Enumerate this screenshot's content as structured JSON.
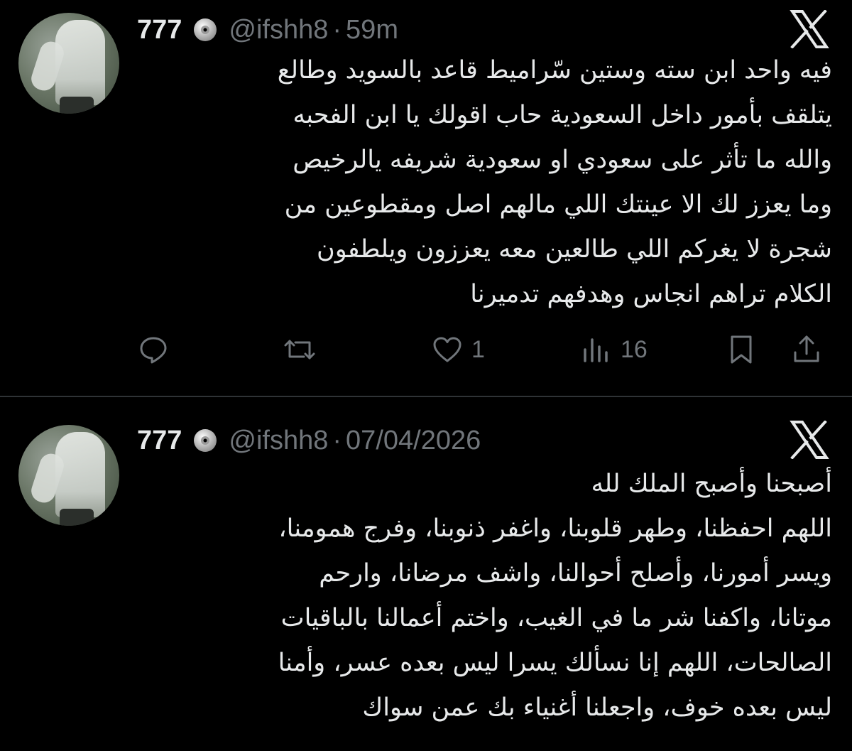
{
  "tweets": [
    {
      "author": {
        "name": "777",
        "handle": "@ifshh8",
        "badge_icon": "cd-disc-icon"
      },
      "separator": "·",
      "time": "59m",
      "platform_icon": "x-logo-icon",
      "text_lines": [
        "فيه واحد ابن سته وستين سّراميط قاعد بالسويد وطالع",
        "يتلقف بأمور داخل السعودية حاب اقولك يا ابن الفحبه",
        "والله ما تأثر على سعودي او سعودية شريفه يالرخيص",
        "وما يعزز لك الا عينتك اللي مالهم اصل ومقطوعين من",
        "شجرة لا يغركم اللي طالعين معه يعززون ويلطفون",
        "الكلام تراهم انجاس وهدفهم تدميرنا"
      ],
      "actions": {
        "reply": {
          "icon": "reply-icon",
          "count": ""
        },
        "retweet": {
          "icon": "retweet-icon",
          "count": ""
        },
        "like": {
          "icon": "heart-icon",
          "count": "1"
        },
        "views": {
          "icon": "views-icon",
          "count": "16"
        },
        "bookmark": {
          "icon": "bookmark-icon",
          "count": ""
        },
        "share": {
          "icon": "share-icon",
          "count": ""
        }
      }
    },
    {
      "author": {
        "name": "777",
        "handle": "@ifshh8",
        "badge_icon": "cd-disc-icon"
      },
      "separator": "·",
      "time": "07/04/2026",
      "platform_icon": "x-logo-icon",
      "text_lines": [
        "أصبحنا وأصبح الملك لله",
        "اللهم احفظنا، وطهر قلوبنا، واغفر ذنوبنا، وفرج همومنا،",
        "ويسر أمورنا، وأصلح أحوالنا، واشف مرضانا، وارحم",
        "موتانا، واكفنا شر ما في الغيب، واختم أعمالنا بالباقيات",
        "الصالحات، اللهم إنا نسألك يسرا ليس بعده عسر، وأمنا",
        "ليس بعده خوف، واجعلنا أغنياء بك عمن سواك"
      ]
    }
  ],
  "colors": {
    "background": "#000000",
    "text": "#e7e9ea",
    "muted": "#71767b",
    "divider": "#2f3336"
  }
}
